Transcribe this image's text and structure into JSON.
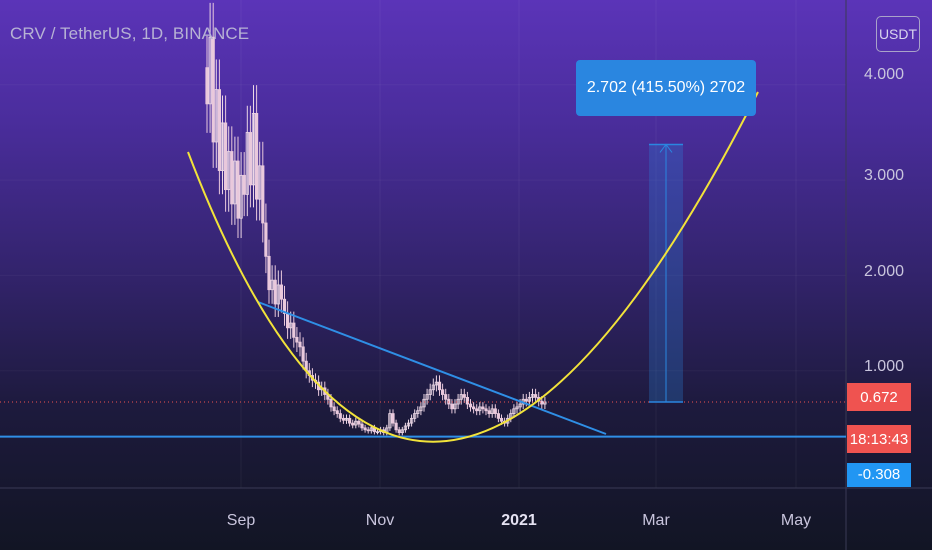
{
  "header": {
    "symbol_title": "CRV / TetherUS, 1D, BINANCE",
    "currency_button": "USDT"
  },
  "price_axis": {
    "ticks": [
      "4.000",
      "3.000",
      "2.000",
      "1.000"
    ]
  },
  "time_axis": {
    "ticks": [
      "Sep",
      "Nov",
      "2021",
      "Mar",
      "May"
    ]
  },
  "badges": {
    "last_price": "0.672",
    "countdown": "18:13:43",
    "support_level": "0.308"
  },
  "measure_label": "2.702 (415.50%) 2702",
  "colors": {
    "up_candle": "#ecd8e6",
    "down_candle": "#e9c9dc",
    "trendline": "#2f8fe6",
    "curve": "#f2e33a",
    "last_price_badge": "#ef5350",
    "support_badge": "#2196f3",
    "measure_fill": "#2a86e0"
  },
  "chart_data": {
    "type": "candlestick",
    "symbol": "CRV / TetherUS",
    "interval": "1D",
    "exchange": "BINANCE",
    "quote_currency": "USDT",
    "y_ticks": [
      4.0,
      3.0,
      2.0,
      1.0
    ],
    "x_ticks": [
      "Sep",
      "Nov",
      "2021",
      "Mar",
      "May"
    ],
    "last_price": 0.672,
    "support_level": 0.308,
    "bar_countdown": "18:13:43",
    "measurement": {
      "from": 0.672,
      "to": 3.374,
      "change": 2.702,
      "change_percent": 415.5,
      "ticks": 2702,
      "label": "2.702 (415.50%) 2702"
    },
    "candles_close": [
      3.8,
      4.5,
      3.4,
      3.95,
      3.1,
      3.6,
      2.9,
      3.3,
      2.75,
      3.2,
      2.6,
      3.05,
      2.85,
      3.5,
      2.95,
      3.7,
      2.8,
      3.15,
      2.55,
      2.2,
      1.85,
      1.95,
      1.7,
      1.9,
      1.75,
      1.6,
      1.45,
      1.5,
      1.35,
      1.3,
      1.25,
      1.1,
      1.0,
      0.95,
      0.9,
      0.88,
      0.8,
      0.82,
      0.75,
      0.7,
      0.62,
      0.58,
      0.55,
      0.5,
      0.48,
      0.5,
      0.45,
      0.43,
      0.47,
      0.44,
      0.4,
      0.38,
      0.37,
      0.4,
      0.36,
      0.36,
      0.38,
      0.35,
      0.4,
      0.55,
      0.45,
      0.38,
      0.35,
      0.38,
      0.42,
      0.45,
      0.5,
      0.55,
      0.58,
      0.62,
      0.7,
      0.75,
      0.8,
      0.85,
      0.88,
      0.8,
      0.75,
      0.7,
      0.65,
      0.6,
      0.65,
      0.7,
      0.75,
      0.72,
      0.65,
      0.62,
      0.6,
      0.58,
      0.62,
      0.6,
      0.58,
      0.55,
      0.6,
      0.55,
      0.5,
      0.47,
      0.45,
      0.5,
      0.55,
      0.6,
      0.62,
      0.65,
      0.7,
      0.68,
      0.72,
      0.75,
      0.72,
      0.68,
      0.65,
      0.672
    ]
  }
}
